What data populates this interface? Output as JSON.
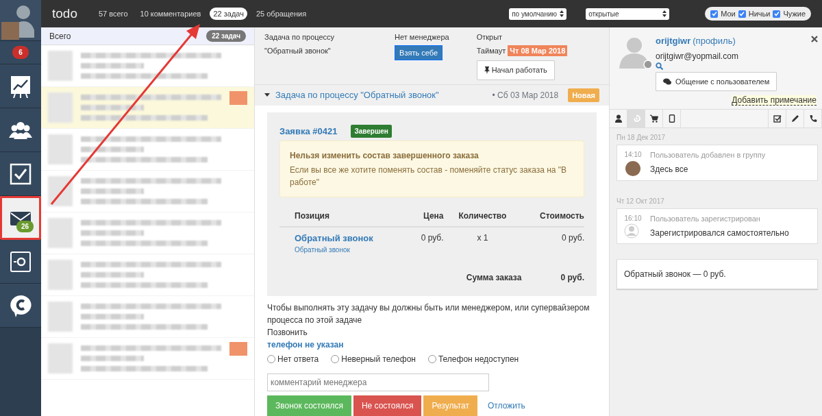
{
  "rail": {
    "badge": "6",
    "items": [
      {
        "kind": "chart",
        "selected": false,
        "highlighted": false
      },
      {
        "kind": "people",
        "selected": false,
        "highlighted": false
      },
      {
        "kind": "check",
        "selected": false,
        "highlighted": false
      },
      {
        "kind": "mail",
        "selected": true,
        "highlighted": true,
        "badge": "26"
      },
      {
        "kind": "safe",
        "selected": false,
        "highlighted": false
      },
      {
        "kind": "chat",
        "selected": false,
        "highlighted": false
      }
    ]
  },
  "topbar": {
    "title": "todo",
    "filters": [
      {
        "label": "57 всего",
        "selected": false
      },
      {
        "label": "10 комментариев",
        "selected": false
      },
      {
        "label": "22 задач",
        "selected": true
      },
      {
        "label": "25 обращения",
        "selected": false
      }
    ],
    "sort": "по умолчанию",
    "status": "открытые",
    "owners": [
      {
        "label": "Мои",
        "checked": true
      },
      {
        "label": "Ничьи",
        "checked": true
      },
      {
        "label": "Чужие",
        "checked": true
      }
    ]
  },
  "list": {
    "title": "Всего",
    "count": "22 задач",
    "rows": [
      {
        "selected": false,
        "flagged": false
      },
      {
        "selected": true,
        "flagged": true
      },
      {
        "selected": false,
        "flagged": false
      },
      {
        "selected": false,
        "flagged": false
      },
      {
        "selected": false,
        "flagged": false
      },
      {
        "selected": false,
        "flagged": false
      },
      {
        "selected": false,
        "flagged": false
      },
      {
        "selected": false,
        "flagged": true
      }
    ]
  },
  "task_header": {
    "process_label": "Задача по процессу",
    "process_name": "\"Обратный звонок\"",
    "manager": "Нет менеджера",
    "take_button": "Взять себе",
    "state": "Открыт",
    "timeout_label": "Таймаут",
    "timeout_date": "Чт 08 Мар 2018",
    "start_button": "Начал работать"
  },
  "task": {
    "title": "Задача по процессу \"Обратный звонок\"",
    "date": "• Сб 03 Мар 2018",
    "badge": "Новая",
    "order": {
      "title": "Заявка #0421",
      "status": "Завершен",
      "alert_title": "Нельзя изменить состав завершенного заказа",
      "alert_text": "Если вы все же хотите поменять состав - поменяйте статус заказа на \"В работе\"",
      "columns": [
        "Позиция",
        "Цена",
        "Количество",
        "Стоимость"
      ],
      "rows": [
        {
          "name": "Обратный звонок",
          "subtitle": "Обратный звонок",
          "price": "0 руб.",
          "quantity": "x 1",
          "cost": "0 руб."
        }
      ],
      "total_label": "Сумма заказа",
      "total": "0 руб."
    },
    "notice": "Чтобы выполнять эту задачу вы должны быть или менеджером, или супервайзером процесса по этой задаче",
    "action": "Позвонить",
    "phone": "телефон не указан",
    "outcomes": [
      {
        "label": "Нет ответа",
        "selected": false
      },
      {
        "label": "Неверный телефон",
        "selected": false
      },
      {
        "label": "Телефон недоступен",
        "selected": false
      }
    ],
    "comment_placeholder": "комментарий менеджера",
    "buttons": [
      {
        "label": "Звонок состоялся",
        "kind": "success"
      },
      {
        "label": "Не состоялся",
        "kind": "danger"
      },
      {
        "label": "Результат",
        "kind": "warning"
      }
    ],
    "postpone": "Отложить"
  },
  "user": {
    "name": "orijtgiwr",
    "profile_link": "(профиль)",
    "email": "orijtgiwr@yopmail.com",
    "chat_button": "Общение с пользователем",
    "add_note": "Добавить примечание",
    "tabs": [
      {
        "kind": "person",
        "selected": false
      },
      {
        "kind": "history",
        "selected": true
      },
      {
        "kind": "cart",
        "selected": false
      },
      {
        "kind": "tablet",
        "selected": false
      },
      {
        "kind": "checkbox",
        "selected": false
      },
      {
        "kind": "pencil",
        "selected": false
      },
      {
        "kind": "phone",
        "selected": false
      }
    ],
    "timeline": [
      {
        "date": "Пн 18 Дек 2017",
        "events": [
          {
            "time": "14:10",
            "title": "Пользователь добавлен в группу",
            "text": "Здесь все",
            "kind": "photo"
          }
        ]
      },
      {
        "date": "Чт 12 Окт 2017",
        "events": [
          {
            "time": "16:10",
            "title": "Пользователь зарегистрирован",
            "text": "Зарегистрировался самостоятельно",
            "kind": "silhouette"
          }
        ]
      }
    ],
    "order_summary": "Обратный звонок — 0 руб."
  }
}
